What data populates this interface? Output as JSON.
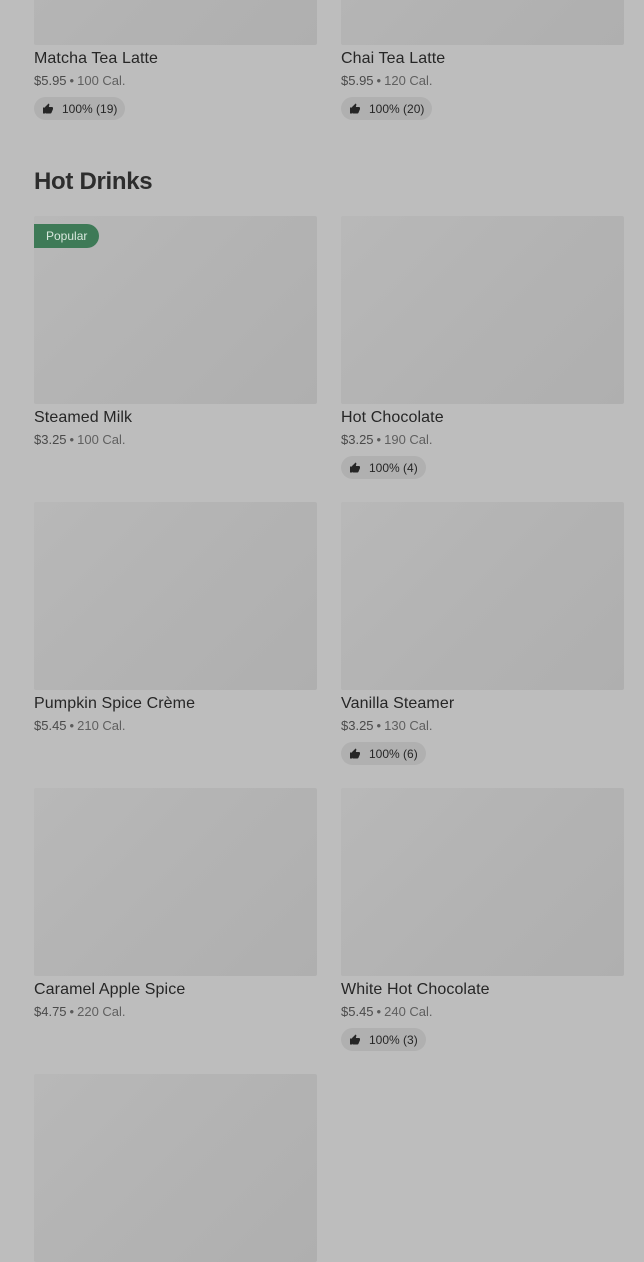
{
  "top_items": [
    {
      "name": "Matcha Tea Latte",
      "price": "$5.95",
      "calories": "100 Cal.",
      "rating": "100% (19)"
    },
    {
      "name": "Chai Tea Latte",
      "price": "$5.95",
      "calories": "120 Cal.",
      "rating": "100% (20)"
    }
  ],
  "section": {
    "title": "Hot Drinks"
  },
  "badge": "Popular",
  "items": [
    {
      "name": "Steamed Milk",
      "price": "$3.25",
      "calories": "100 Cal.",
      "rating": null
    },
    {
      "name": "Hot Chocolate",
      "price": "$3.25",
      "calories": "190 Cal.",
      "rating": "100% (4)"
    },
    {
      "name": "Pumpkin Spice Crème",
      "price": "$5.45",
      "calories": "210 Cal.",
      "rating": null
    },
    {
      "name": "Vanilla Steamer",
      "price": "$3.25",
      "calories": "130 Cal.",
      "rating": "100% (6)"
    },
    {
      "name": "Caramel Apple Spice",
      "price": "$4.75",
      "calories": "220 Cal.",
      "rating": null
    },
    {
      "name": "White Hot Chocolate",
      "price": "$5.45",
      "calories": "240 Cal.",
      "rating": "100% (3)"
    }
  ],
  "separator": "•",
  "icons": {
    "rating": "thumbs-up-icon"
  },
  "colors": {
    "badge": "#3e7a57",
    "background": "#bdbdbd"
  }
}
